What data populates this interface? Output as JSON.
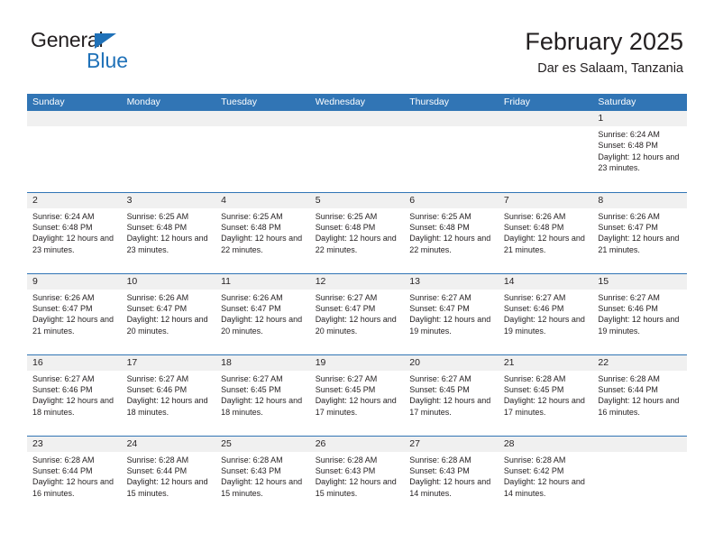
{
  "brand": {
    "name_part1": "General",
    "name_part2": "Blue",
    "logo_icon": "blue-triangle-icon"
  },
  "header": {
    "title": "February 2025",
    "subtitle": "Dar es Salaam, Tanzania"
  },
  "colors": {
    "header_blue": "#3175b5",
    "brand_blue": "#1f71b8",
    "daynum_band": "#f0f0f0",
    "text": "#231f20"
  },
  "calendar": {
    "day_headers": [
      "Sunday",
      "Monday",
      "Tuesday",
      "Wednesday",
      "Thursday",
      "Friday",
      "Saturday"
    ],
    "labels": {
      "sunrise": "Sunrise:",
      "sunset": "Sunset:",
      "daylight": "Daylight:"
    },
    "weeks": [
      [
        {
          "day": "",
          "empty": true
        },
        {
          "day": "",
          "empty": true
        },
        {
          "day": "",
          "empty": true
        },
        {
          "day": "",
          "empty": true
        },
        {
          "day": "",
          "empty": true
        },
        {
          "day": "",
          "empty": true
        },
        {
          "day": "1",
          "sunrise": "Sunrise: 6:24 AM",
          "sunset": "Sunset: 6:48 PM",
          "daylight": "Daylight: 12 hours and 23 minutes."
        }
      ],
      [
        {
          "day": "2",
          "sunrise": "Sunrise: 6:24 AM",
          "sunset": "Sunset: 6:48 PM",
          "daylight": "Daylight: 12 hours and 23 minutes."
        },
        {
          "day": "3",
          "sunrise": "Sunrise: 6:25 AM",
          "sunset": "Sunset: 6:48 PM",
          "daylight": "Daylight: 12 hours and 23 minutes."
        },
        {
          "day": "4",
          "sunrise": "Sunrise: 6:25 AM",
          "sunset": "Sunset: 6:48 PM",
          "daylight": "Daylight: 12 hours and 22 minutes."
        },
        {
          "day": "5",
          "sunrise": "Sunrise: 6:25 AM",
          "sunset": "Sunset: 6:48 PM",
          "daylight": "Daylight: 12 hours and 22 minutes."
        },
        {
          "day": "6",
          "sunrise": "Sunrise: 6:25 AM",
          "sunset": "Sunset: 6:48 PM",
          "daylight": "Daylight: 12 hours and 22 minutes."
        },
        {
          "day": "7",
          "sunrise": "Sunrise: 6:26 AM",
          "sunset": "Sunset: 6:48 PM",
          "daylight": "Daylight: 12 hours and 21 minutes."
        },
        {
          "day": "8",
          "sunrise": "Sunrise: 6:26 AM",
          "sunset": "Sunset: 6:47 PM",
          "daylight": "Daylight: 12 hours and 21 minutes."
        }
      ],
      [
        {
          "day": "9",
          "sunrise": "Sunrise: 6:26 AM",
          "sunset": "Sunset: 6:47 PM",
          "daylight": "Daylight: 12 hours and 21 minutes."
        },
        {
          "day": "10",
          "sunrise": "Sunrise: 6:26 AM",
          "sunset": "Sunset: 6:47 PM",
          "daylight": "Daylight: 12 hours and 20 minutes."
        },
        {
          "day": "11",
          "sunrise": "Sunrise: 6:26 AM",
          "sunset": "Sunset: 6:47 PM",
          "daylight": "Daylight: 12 hours and 20 minutes."
        },
        {
          "day": "12",
          "sunrise": "Sunrise: 6:27 AM",
          "sunset": "Sunset: 6:47 PM",
          "daylight": "Daylight: 12 hours and 20 minutes."
        },
        {
          "day": "13",
          "sunrise": "Sunrise: 6:27 AM",
          "sunset": "Sunset: 6:47 PM",
          "daylight": "Daylight: 12 hours and 19 minutes."
        },
        {
          "day": "14",
          "sunrise": "Sunrise: 6:27 AM",
          "sunset": "Sunset: 6:46 PM",
          "daylight": "Daylight: 12 hours and 19 minutes."
        },
        {
          "day": "15",
          "sunrise": "Sunrise: 6:27 AM",
          "sunset": "Sunset: 6:46 PM",
          "daylight": "Daylight: 12 hours and 19 minutes."
        }
      ],
      [
        {
          "day": "16",
          "sunrise": "Sunrise: 6:27 AM",
          "sunset": "Sunset: 6:46 PM",
          "daylight": "Daylight: 12 hours and 18 minutes."
        },
        {
          "day": "17",
          "sunrise": "Sunrise: 6:27 AM",
          "sunset": "Sunset: 6:46 PM",
          "daylight": "Daylight: 12 hours and 18 minutes."
        },
        {
          "day": "18",
          "sunrise": "Sunrise: 6:27 AM",
          "sunset": "Sunset: 6:45 PM",
          "daylight": "Daylight: 12 hours and 18 minutes."
        },
        {
          "day": "19",
          "sunrise": "Sunrise: 6:27 AM",
          "sunset": "Sunset: 6:45 PM",
          "daylight": "Daylight: 12 hours and 17 minutes."
        },
        {
          "day": "20",
          "sunrise": "Sunrise: 6:27 AM",
          "sunset": "Sunset: 6:45 PM",
          "daylight": "Daylight: 12 hours and 17 minutes."
        },
        {
          "day": "21",
          "sunrise": "Sunrise: 6:28 AM",
          "sunset": "Sunset: 6:45 PM",
          "daylight": "Daylight: 12 hours and 17 minutes."
        },
        {
          "day": "22",
          "sunrise": "Sunrise: 6:28 AM",
          "sunset": "Sunset: 6:44 PM",
          "daylight": "Daylight: 12 hours and 16 minutes."
        }
      ],
      [
        {
          "day": "23",
          "sunrise": "Sunrise: 6:28 AM",
          "sunset": "Sunset: 6:44 PM",
          "daylight": "Daylight: 12 hours and 16 minutes."
        },
        {
          "day": "24",
          "sunrise": "Sunrise: 6:28 AM",
          "sunset": "Sunset: 6:44 PM",
          "daylight": "Daylight: 12 hours and 15 minutes."
        },
        {
          "day": "25",
          "sunrise": "Sunrise: 6:28 AM",
          "sunset": "Sunset: 6:43 PM",
          "daylight": "Daylight: 12 hours and 15 minutes."
        },
        {
          "day": "26",
          "sunrise": "Sunrise: 6:28 AM",
          "sunset": "Sunset: 6:43 PM",
          "daylight": "Daylight: 12 hours and 15 minutes."
        },
        {
          "day": "27",
          "sunrise": "Sunrise: 6:28 AM",
          "sunset": "Sunset: 6:43 PM",
          "daylight": "Daylight: 12 hours and 14 minutes."
        },
        {
          "day": "28",
          "sunrise": "Sunrise: 6:28 AM",
          "sunset": "Sunset: 6:42 PM",
          "daylight": "Daylight: 12 hours and 14 minutes."
        },
        {
          "day": "",
          "empty": true
        }
      ]
    ]
  }
}
